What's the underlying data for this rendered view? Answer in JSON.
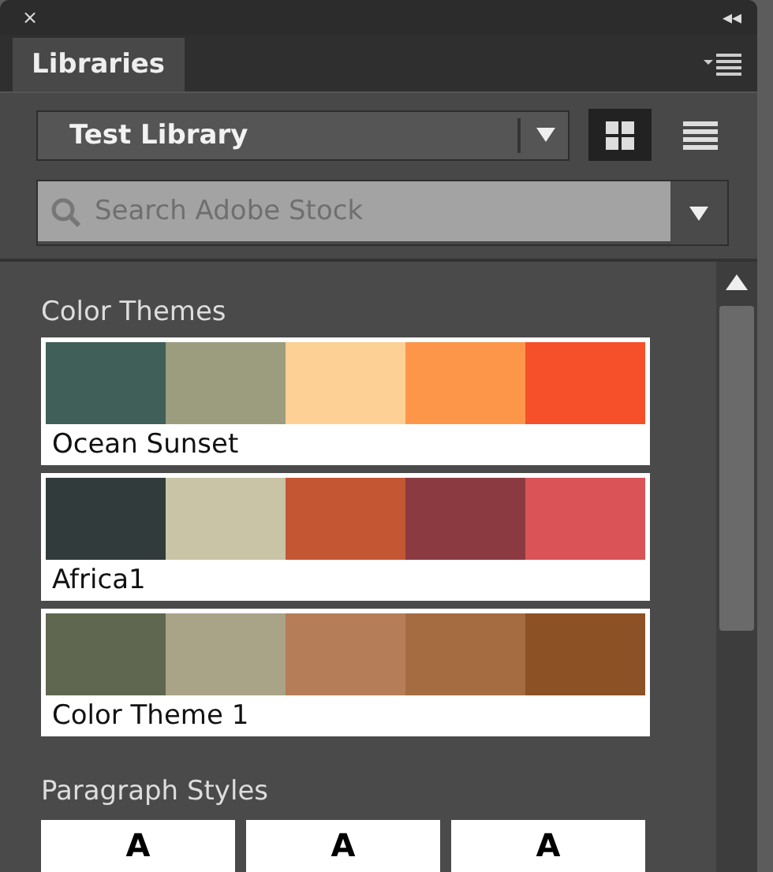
{
  "panel": {
    "close": "×",
    "collapse": "◂◂"
  },
  "tabs": [
    {
      "label": "Libraries",
      "selected": true
    }
  ],
  "library_select": {
    "value": "Test Library"
  },
  "view_buttons": [
    {
      "kind": "grid",
      "selected": true
    },
    {
      "kind": "list",
      "selected": false
    }
  ],
  "search": {
    "placeholder": "Search Adobe Stock"
  },
  "color_themes": {
    "title": "Color Themes",
    "themes": [
      {
        "name": "Ocean Sunset",
        "swatches": [
          {
            "color": "#3f5f58"
          },
          {
            "color": "#9b9d7e"
          },
          {
            "color": "#fdd096"
          },
          {
            "color": "#fd9649"
          },
          {
            "color": "#f5502a"
          }
        ]
      },
      {
        "name": "Africa1",
        "swatches": [
          {
            "color": "#323b3b"
          },
          {
            "color": "#c9c4a6"
          },
          {
            "color": "#c45634"
          },
          {
            "color": "#8a3a40"
          },
          {
            "color": "#d95357"
          }
        ]
      },
      {
        "name": "Color Theme 1",
        "swatches": [
          {
            "color": "#606750"
          },
          {
            "color": "#a9a487"
          },
          {
            "color": "#b57d58"
          },
          {
            "color": "#a46c40"
          },
          {
            "color": "#8c5124"
          }
        ]
      }
    ]
  },
  "paragraph_styles": {
    "title": "Paragraph Styles",
    "items": [
      {
        "preview": "A"
      },
      {
        "preview": "A"
      },
      {
        "preview": "A"
      }
    ]
  }
}
